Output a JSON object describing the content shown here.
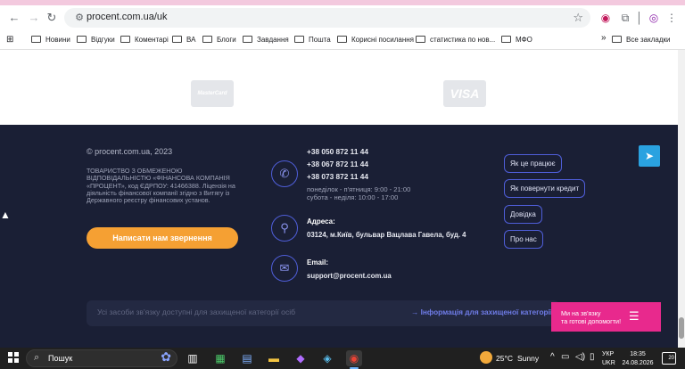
{
  "browser": {
    "url": "procent.com.ua/uk",
    "bookmarks": [
      "Новини",
      "Відгуки",
      "Коментарі",
      "ВА",
      "Блоги",
      "Завдання",
      "Пошта",
      "Корисні посилання",
      "статистика по нов...",
      "МФО"
    ],
    "all_bookmarks": "Все закладки",
    "more": "»"
  },
  "payment_logos": {
    "mastercard": "MasterCard",
    "visa": "VISA"
  },
  "footer": {
    "copyright": "© procent.com.ua, 2023",
    "legal": "ТОВАРИСТВО З ОБМЕЖЕНОЮ ВІДПОВІДАЛЬНІСТЮ «ФІНАНСОВА КОМПАНІЯ «ПРОЦЕНТ», код ЄДРПОУ: 41466388. Ліцензія на діяльність фінансової компанії згідно з Витягу із Державного реєстру фінансових установ.",
    "write_button": "Написати нам звернення",
    "phones": [
      "+38 050 872 11 44",
      "+38 067 872 11 44",
      "+38 073 872 11 44"
    ],
    "schedule": [
      "понеділок - п'ятниця: 9:00 - 21:00",
      "субота - неділя: 10:00 - 17:00"
    ],
    "address_title": "Адреса:",
    "address": "03124, м.Київ, бульвар Вацлава Гавела, буд. 4",
    "email_title": "Email:",
    "email": "support@procent.com.ua",
    "links": [
      "Як це працює",
      "Як повернути кредит",
      "Довідка",
      "Про нас"
    ],
    "notice": "Усі засоби зв'язку доступні для захищеної категорії осіб",
    "notice_link": "→ Інформація для захищеної категорії"
  },
  "help_widget": {
    "line1": "Ми на зв'язку",
    "line2": "та готові допомогти!"
  },
  "taskbar": {
    "search_placeholder": "Пошук",
    "temperature": "25°C",
    "weather": "Sunny",
    "lang_top": "УКР",
    "lang_bottom": "UKR",
    "time": "18:35",
    "date": "24.08.2026",
    "notifications": "20"
  }
}
